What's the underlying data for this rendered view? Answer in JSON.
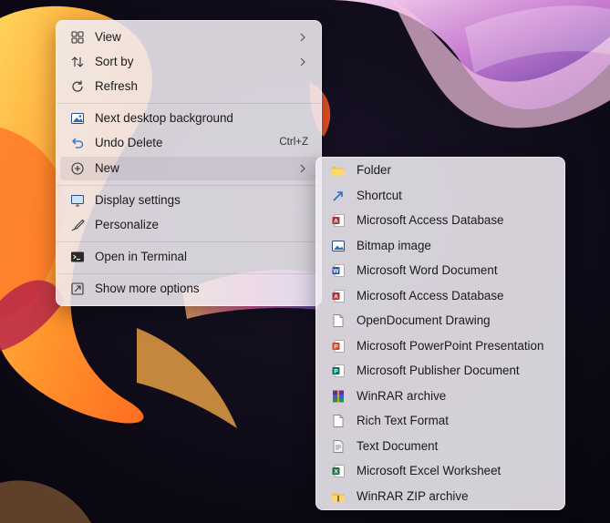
{
  "context_menu": {
    "items": [
      {
        "label": "View",
        "icon": "grid-view-icon",
        "has_submenu": true
      },
      {
        "label": "Sort by",
        "icon": "sort-arrows-icon",
        "has_submenu": true
      },
      {
        "label": "Refresh",
        "icon": "refresh-icon"
      },
      {
        "label": "Next desktop background",
        "icon": "next-background-icon"
      },
      {
        "label": "Undo Delete",
        "icon": "undo-icon",
        "shortcut": "Ctrl+Z"
      },
      {
        "label": "New",
        "icon": "plus-circle-icon",
        "has_submenu": true
      },
      {
        "label": "Display settings",
        "icon": "display-settings-icon"
      },
      {
        "label": "Personalize",
        "icon": "brush-icon"
      },
      {
        "label": "Open in Terminal",
        "icon": "terminal-icon"
      },
      {
        "label": "Show more options",
        "icon": "show-more-options-icon"
      }
    ]
  },
  "new_submenu": {
    "items": [
      {
        "label": "Folder",
        "icon": "folder-icon"
      },
      {
        "label": "Shortcut",
        "icon": "shortcut-icon"
      },
      {
        "label": "Microsoft Access Database",
        "icon": "access-icon"
      },
      {
        "label": "Bitmap image",
        "icon": "bitmap-icon"
      },
      {
        "label": "Microsoft Word Document",
        "icon": "word-icon"
      },
      {
        "label": "Microsoft Access Database",
        "icon": "access-icon"
      },
      {
        "label": "OpenDocument Drawing",
        "icon": "blank-document-icon"
      },
      {
        "label": "Microsoft PowerPoint Presentation",
        "icon": "powerpoint-icon"
      },
      {
        "label": "Microsoft Publisher Document",
        "icon": "publisher-icon"
      },
      {
        "label": "WinRAR archive",
        "icon": "winrar-icon"
      },
      {
        "label": "Rich Text Format",
        "icon": "blank-document-icon"
      },
      {
        "label": "Text Document",
        "icon": "text-document-icon"
      },
      {
        "label": "Microsoft Excel Worksheet",
        "icon": "excel-icon"
      },
      {
        "label": "WinRAR ZIP archive",
        "icon": "winrar-zip-icon"
      }
    ]
  },
  "colors": {
    "word": "#2b579a",
    "excel": "#217346",
    "powerpoint": "#d24726",
    "publisher": "#077568",
    "access": "#a4373a",
    "folder": "#f3c245"
  }
}
